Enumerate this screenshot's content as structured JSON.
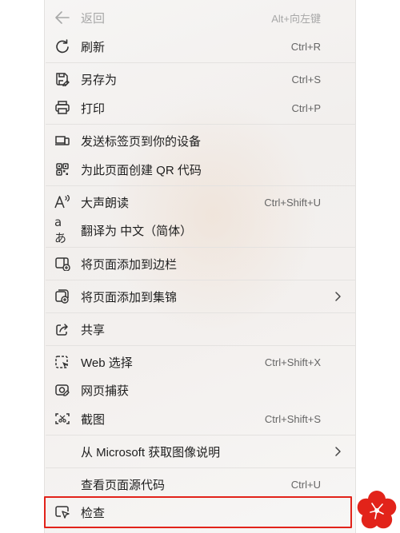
{
  "menu": {
    "items": [
      {
        "label": "返回",
        "shortcut": "Alt+向左键",
        "icon": "back-arrow-icon"
      },
      {
        "label": "刷新",
        "shortcut": "Ctrl+R",
        "icon": "refresh-icon"
      },
      {
        "label": "另存为",
        "shortcut": "Ctrl+S",
        "icon": "save-as-icon"
      },
      {
        "label": "打印",
        "shortcut": "Ctrl+P",
        "icon": "printer-icon"
      },
      {
        "label": "发送标签页到你的设备",
        "shortcut": "",
        "icon": "send-to-devices-icon"
      },
      {
        "label": "为此页面创建 QR 代码",
        "shortcut": "",
        "icon": "qr-code-icon"
      },
      {
        "label": "大声朗读",
        "shortcut": "Ctrl+Shift+U",
        "icon": "read-aloud-icon"
      },
      {
        "label": "翻译为 中文（简体）",
        "shortcut": "",
        "icon": "translate-icon"
      },
      {
        "label": "将页面添加到边栏",
        "shortcut": "",
        "icon": "add-to-sidebar-icon"
      },
      {
        "label": "将页面添加到集锦",
        "shortcut": "",
        "icon": "add-to-collections-icon"
      },
      {
        "label": "共享",
        "shortcut": "",
        "icon": "share-icon"
      },
      {
        "label": "Web 选择",
        "shortcut": "Ctrl+Shift+X",
        "icon": "web-select-icon"
      },
      {
        "label": "网页捕获",
        "shortcut": "",
        "icon": "web-capture-icon"
      },
      {
        "label": "截图",
        "shortcut": "Ctrl+Shift+S",
        "icon": "screenshot-icon"
      },
      {
        "label": "从 Microsoft 获取图像说明",
        "shortcut": "",
        "icon": ""
      },
      {
        "label": "查看页面源代码",
        "shortcut": "Ctrl+U",
        "icon": ""
      },
      {
        "label": "检查",
        "shortcut": "",
        "icon": "inspect-icon"
      }
    ]
  },
  "colors": {
    "highlight_border": "#e2231a",
    "badge": "#e2231a",
    "disabled_text": "#a8a8a8"
  }
}
